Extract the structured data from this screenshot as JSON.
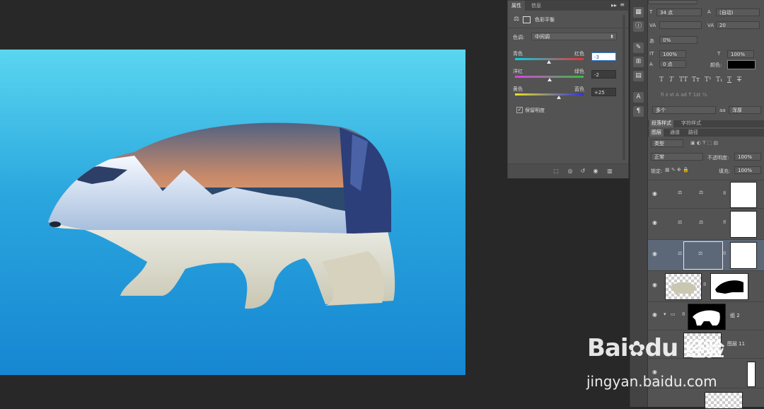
{
  "properties_panel": {
    "tabs": [
      "属性",
      "信息"
    ],
    "adjustment_title": "色彩平衡",
    "tone_label": "色调:",
    "tone_value": "中间调",
    "sliders": [
      {
        "left": "青色",
        "right": "红色",
        "value": "-3",
        "pos": 0.48
      },
      {
        "left": "洋红",
        "right": "绿色",
        "value": "-2",
        "pos": 0.49
      },
      {
        "left": "黄色",
        "right": "蓝色",
        "value": "+25",
        "pos": 0.62
      }
    ],
    "preserve_luminosity_label": "保留明度",
    "preserve_luminosity_checked": true
  },
  "character_panel": {
    "font_size": "34 点",
    "leading": "(自动)",
    "tracking": "20",
    "scale_percent": "0%",
    "vertical_scale": "100%",
    "horizontal_scale": "100%",
    "baseline_shift": "0 点",
    "color_label": "颜色:",
    "language": "多个",
    "antialias_label": "aa",
    "antialias": "浑厚"
  },
  "paragraph_tabs": [
    "段落样式",
    "字符样式"
  ],
  "layers_panel": {
    "tabs": [
      "图层",
      "通道",
      "路径"
    ],
    "filter_label": "类型",
    "blend_mode": "正常",
    "opacity_label": "不透明度:",
    "opacity": "100%",
    "lock_label": "锁定:",
    "fill_label": "填充:",
    "fill": "100%",
    "layers": [
      {
        "type": "adjustment",
        "name": ""
      },
      {
        "type": "adjustment",
        "name": ""
      },
      {
        "type": "adjustment-selected",
        "name": ""
      },
      {
        "type": "image-mask",
        "name": ""
      },
      {
        "type": "group",
        "name": "组 2"
      },
      {
        "type": "layer",
        "name": "图层 11"
      }
    ]
  },
  "watermark": {
    "logo_text": "Bai",
    "logo_text2": "du",
    "logo_cn": "经验",
    "url": "jingyan.baidu.com"
  }
}
